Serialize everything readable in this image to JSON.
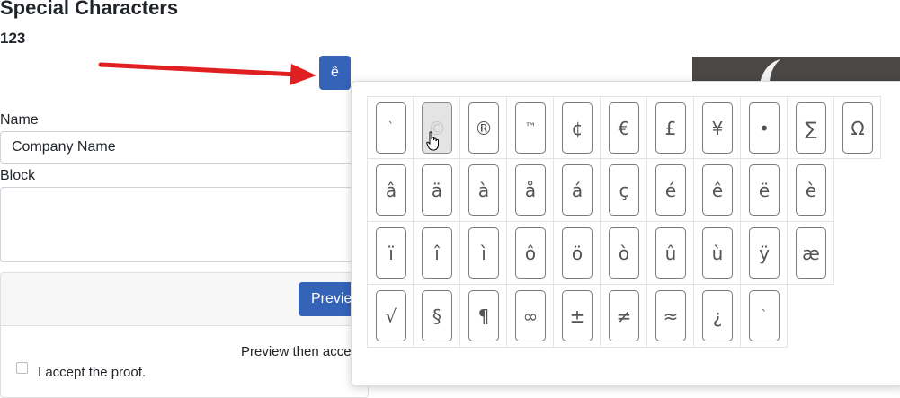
{
  "page": {
    "title": "Special Characters",
    "subtitle": "123"
  },
  "trigger": {
    "label": "ê"
  },
  "form": {
    "name_label": "Name",
    "name_value": "Company Name",
    "block_label": "Block"
  },
  "preview": {
    "button_label": "Preview",
    "note": "Preview then accept",
    "accept_label": "I accept the proof."
  },
  "characters": [
    [
      "`",
      "©",
      "®",
      "™",
      "¢",
      "€",
      "£",
      "¥",
      "•",
      "∑",
      "Ω"
    ],
    [
      "â",
      "ä",
      "à",
      "å",
      "á",
      "ç",
      "é",
      "ê",
      "ë",
      "è"
    ],
    [
      "ï",
      "î",
      "ì",
      "ô",
      "ö",
      "ò",
      "û",
      "ù",
      "ÿ",
      "æ"
    ],
    [
      "√",
      "§",
      "¶",
      "∞",
      "±",
      "≠",
      "≈",
      "¿",
      "`"
    ]
  ],
  "hovered_character": "©",
  "colors": {
    "primary": "#3563b8",
    "arrow": "#e02020",
    "hover": "#e4e4e4"
  }
}
